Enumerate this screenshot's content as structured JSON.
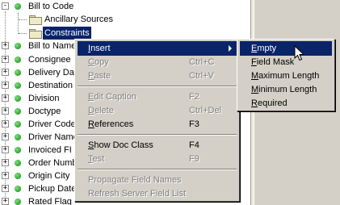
{
  "tree": {
    "items": [
      {
        "label": "Bill to Code",
        "expander": "-"
      },
      {
        "label": "Ancillary Sources"
      },
      {
        "label": "Constraints"
      },
      {
        "label": "Bill to Name",
        "expander": "+"
      },
      {
        "label": "Consignee",
        "expander": "+"
      },
      {
        "label": "Delivery Date",
        "expander": "+"
      },
      {
        "label": "Destination",
        "expander": "+"
      },
      {
        "label": "Division",
        "expander": "+"
      },
      {
        "label": "Doctype",
        "expander": "+"
      },
      {
        "label": "Driver Code",
        "expander": "+"
      },
      {
        "label": "Driver Name",
        "expander": "+"
      },
      {
        "label": "Invoiced FI",
        "expander": "+"
      },
      {
        "label": "Order Numb",
        "expander": "+"
      },
      {
        "label": "Origin City",
        "expander": "+"
      },
      {
        "label": "Pickup Date",
        "expander": "+"
      },
      {
        "label": "Rated Flag",
        "expander": "+"
      }
    ]
  },
  "context_menu": {
    "items": [
      {
        "label": "Insert",
        "underline": "I",
        "rest": "nsert",
        "shortcut": "",
        "enabled": true,
        "highlighted": true,
        "submenu": true
      },
      {
        "label": "Copy",
        "underline": "C",
        "rest": "opy",
        "shortcut": "Ctrl+C",
        "enabled": false
      },
      {
        "label": "Paste",
        "underline": "P",
        "rest": "aste",
        "shortcut": "Ctrl+V",
        "enabled": false
      },
      {
        "label": "Edit Caption",
        "underline": "E",
        "rest": "dit Caption",
        "shortcut": "F2",
        "enabled": false
      },
      {
        "label": "Delete",
        "underline": "D",
        "rest": "elete",
        "shortcut": "Ctrl+Del",
        "enabled": false
      },
      {
        "label": "References",
        "underline": "R",
        "rest": "eferences",
        "shortcut": "F3",
        "enabled": true
      },
      {
        "label": "Show Doc Class",
        "underline": "S",
        "rest": "how Doc Class",
        "shortcut": "F4",
        "enabled": true
      },
      {
        "label": "Test",
        "underline": "T",
        "rest": "est",
        "shortcut": "F9",
        "enabled": false
      },
      {
        "label": "Propagate Field Names",
        "underline": "",
        "rest": "Propagate Field Names",
        "shortcut": "",
        "enabled": false
      },
      {
        "label": "Refresh Server Field List",
        "underline": "",
        "rest": "Refresh Server Field List",
        "shortcut": "",
        "enabled": false
      }
    ]
  },
  "submenu": {
    "items": [
      {
        "label": "Empty",
        "underline": "E",
        "rest": "mpty",
        "highlighted": true
      },
      {
        "label": "Field Mask",
        "underline": "F",
        "rest": "ield Mask"
      },
      {
        "label": "Maximum Length",
        "underline": "M",
        "rest": "aximum Length"
      },
      {
        "label": "Minimum Length",
        "underline": "M",
        "rest": "inimum Length"
      },
      {
        "label": "Required",
        "underline": "R",
        "rest": "equired"
      }
    ]
  },
  "colors": {
    "highlight": "#0a246a",
    "menu_bg": "#d4d0c8",
    "node_dot": "#0a8a0a"
  }
}
